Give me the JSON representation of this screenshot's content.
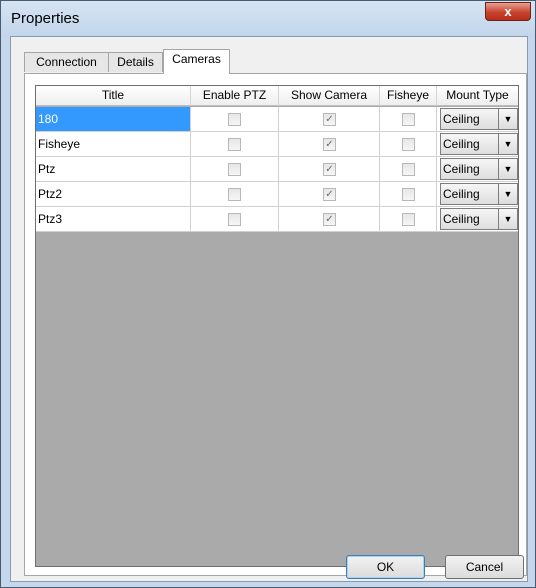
{
  "window": {
    "title": "Properties",
    "close_glyph": "x"
  },
  "tabs": [
    {
      "label": "Connection",
      "active": false
    },
    {
      "label": "Details",
      "active": false
    },
    {
      "label": "Cameras",
      "active": true
    }
  ],
  "grid": {
    "columns": [
      "Title",
      "Enable PTZ",
      "Show Camera",
      "Fisheye",
      "Mount Type"
    ],
    "rows": [
      {
        "title": "180",
        "enable_ptz": false,
        "show_camera": true,
        "fisheye": false,
        "mount_type": "Ceiling",
        "selected": true
      },
      {
        "title": "Fisheye",
        "enable_ptz": false,
        "show_camera": true,
        "fisheye": false,
        "mount_type": "Ceiling",
        "selected": false
      },
      {
        "title": "Ptz",
        "enable_ptz": false,
        "show_camera": true,
        "fisheye": false,
        "mount_type": "Ceiling",
        "selected": false
      },
      {
        "title": "Ptz2",
        "enable_ptz": false,
        "show_camera": true,
        "fisheye": false,
        "mount_type": "Ceiling",
        "selected": false
      },
      {
        "title": "Ptz3",
        "enable_ptz": false,
        "show_camera": true,
        "fisheye": false,
        "mount_type": "Ceiling",
        "selected": false
      }
    ]
  },
  "buttons": {
    "ok": "OK",
    "cancel": "Cancel"
  },
  "colors": {
    "selection": "#3399ff",
    "grid_empty": "#aaaaaa",
    "window_frame": "#c5d7ec"
  },
  "icons": {
    "close": "close-icon",
    "dropdown": "chevron-down-icon",
    "check": "checkmark-icon"
  }
}
